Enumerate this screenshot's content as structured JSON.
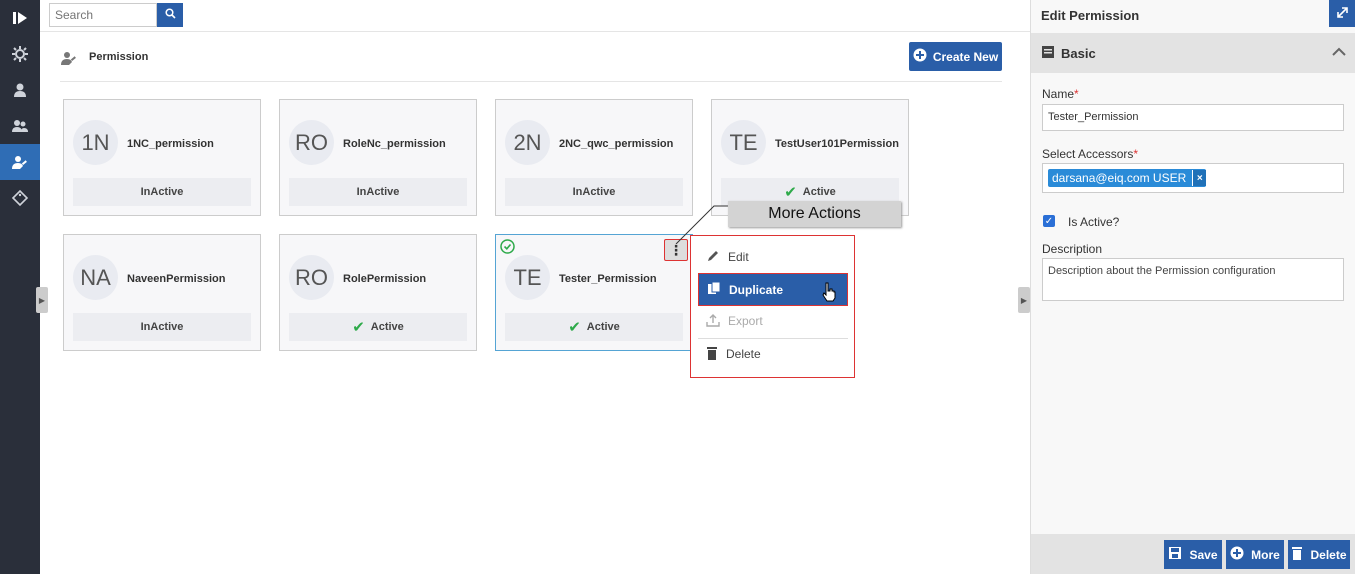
{
  "nav": {
    "items": [
      {
        "icon": "logo-icon"
      },
      {
        "icon": "gear-icon"
      },
      {
        "icon": "user-icon"
      },
      {
        "icon": "users-icon"
      },
      {
        "icon": "permission-icon",
        "active": true
      },
      {
        "icon": "tag-icon"
      }
    ]
  },
  "search": {
    "placeholder": "Search"
  },
  "page": {
    "title": "Permission",
    "create_label": "Create New"
  },
  "cards": [
    {
      "initials": "1N",
      "name": "1NC_permission",
      "status": "InActive",
      "active": false
    },
    {
      "initials": "RO",
      "name": "RoleNc_permission",
      "status": "InActive",
      "active": false
    },
    {
      "initials": "2N",
      "name": "2NC_qwc_permission",
      "status": "InActive",
      "active": false
    },
    {
      "initials": "TE",
      "name": "TestUser101Permission",
      "status": "Active",
      "active": true
    },
    {
      "initials": "NA",
      "name": "NaveenPermission",
      "status": "InActive",
      "active": false
    },
    {
      "initials": "RO",
      "name": "RolePermission",
      "status": "Active",
      "active": true
    },
    {
      "initials": "TE",
      "name": "Tester_Permission",
      "status": "Active",
      "active": true,
      "selected": true
    }
  ],
  "menu": {
    "edit": "Edit",
    "duplicate": "Duplicate",
    "export": "Export",
    "delete": "Delete"
  },
  "callout": "More Actions",
  "panel": {
    "title": "Edit Permission",
    "section": "Basic",
    "name_label": "Name",
    "name_value": "Tester_Permission",
    "accessors_label": "Select Accessors",
    "accessor_tag": "darsana@eiq.com USER",
    "active_label": "Is Active?",
    "description_label": "Description",
    "description_value": "Description about the Permission configuration",
    "save": "Save",
    "more": "More",
    "delete": "Delete"
  },
  "colors": {
    "accent": "#2a5ea8",
    "active_check": "#2eaa4a",
    "nav_bg": "#2a2f3a"
  }
}
